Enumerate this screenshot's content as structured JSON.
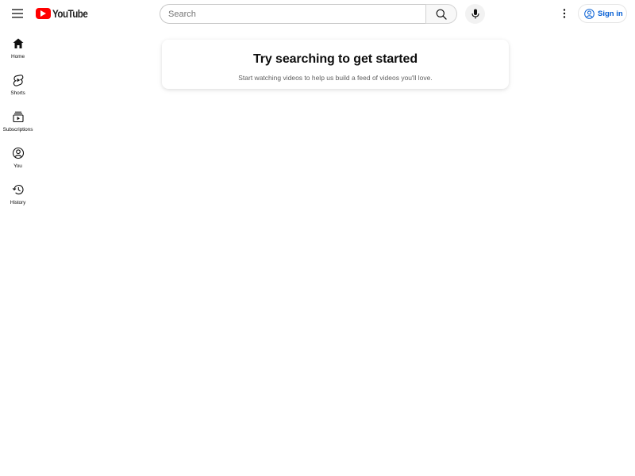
{
  "masthead": {
    "logo_text": "YouTube",
    "search": {
      "placeholder": "Search",
      "value": ""
    },
    "sign_in_label": "Sign in",
    "brand_color": "#ff0000",
    "link_color": "#065fd4"
  },
  "guide": {
    "items": [
      {
        "label": "Home",
        "icon": "home-icon"
      },
      {
        "label": "Shorts",
        "icon": "shorts-icon"
      },
      {
        "label": "Subscriptions",
        "icon": "subscriptions-icon"
      },
      {
        "label": "You",
        "icon": "you-icon"
      },
      {
        "label": "History",
        "icon": "history-icon"
      }
    ]
  },
  "feed": {
    "title": "Try searching to get started",
    "subtitle": "Start watching videos to help us build a feed of videos you'll love."
  }
}
